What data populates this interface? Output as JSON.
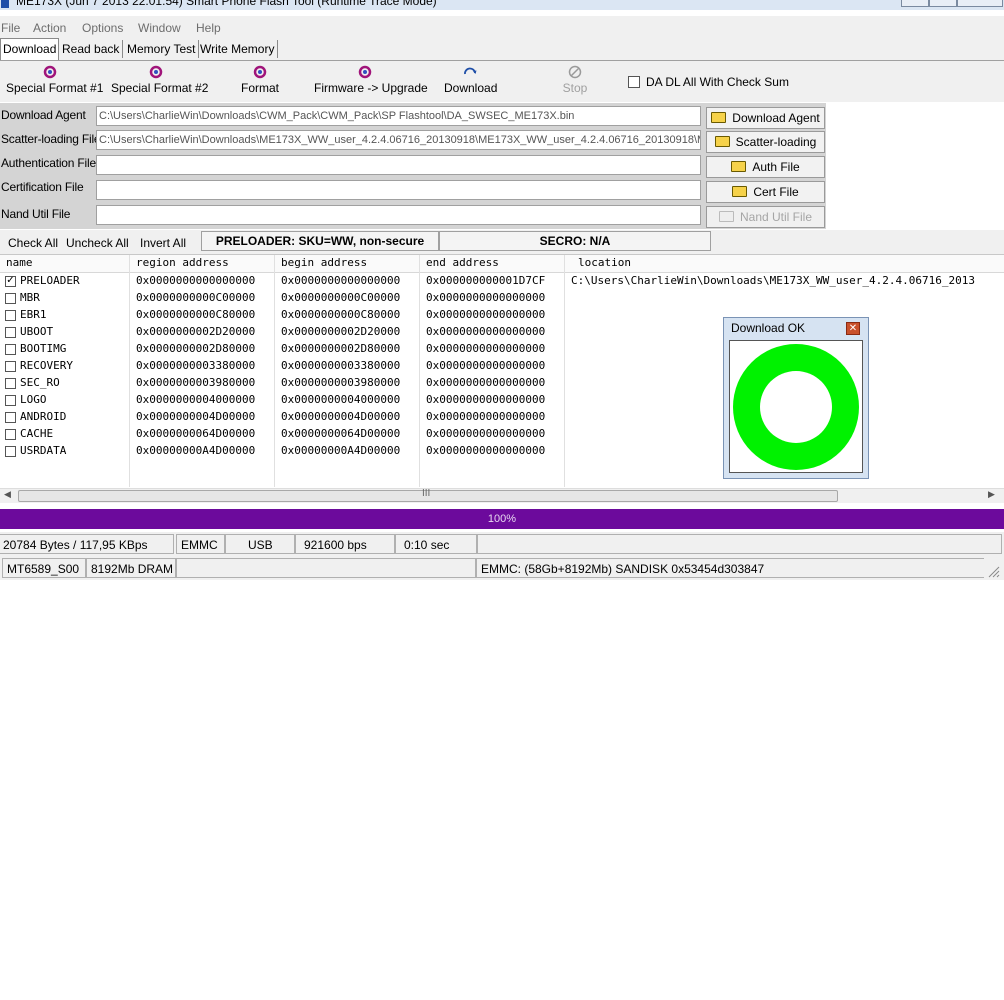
{
  "window": {
    "title": "ME173X (Jun  7 2013 22:01:54) Smart Phone Flash Tool (Runtime Trace Mode)"
  },
  "menu": [
    "File",
    "Action",
    "Options",
    "Window",
    "Help"
  ],
  "tabs": [
    "Download",
    "Read back",
    "Memory Test",
    "Write Memory"
  ],
  "toolbar": {
    "special_format_1": "Special Format #1",
    "special_format_2": "Special Format #2",
    "format": "Format",
    "firmware_upgrade": "Firmware -> Upgrade",
    "download": "Download",
    "stop": "Stop",
    "checksum_label": "DA DL All With Check Sum"
  },
  "files": {
    "download_agent": {
      "label": "Download Agent",
      "value": "C:\\Users\\CharlieWin\\Downloads\\CWM_Pack\\CWM_Pack\\SP Flashtool\\DA_SWSEC_ME173X.bin",
      "button": "Download Agent"
    },
    "scatter": {
      "label": "Scatter-loading File",
      "value": "C:\\Users\\CharlieWin\\Downloads\\ME173X_WW_user_4.2.4.06716_20130918\\ME173X_WW_user_4.2.4.06716_20130918\\M",
      "button": "Scatter-loading"
    },
    "auth": {
      "label": "Authentication File",
      "value": "",
      "button": "Auth File"
    },
    "cert": {
      "label": "Certification File",
      "value": "",
      "button": "Cert File"
    },
    "nand": {
      "label": "Nand Util File",
      "value": "",
      "button": "Nand Util File"
    }
  },
  "checks": {
    "check_all": "Check All",
    "uncheck_all": "Uncheck All",
    "invert_all": "Invert All",
    "preloader_info": "PRELOADER: SKU=WW, non-secure",
    "secro_info": "SECRO: N/A"
  },
  "table": {
    "columns": [
      "name",
      "region address",
      "begin address",
      "end address",
      "location"
    ],
    "rows": [
      {
        "checked": true,
        "name": "PRELOADER",
        "region": "0x0000000000000000",
        "begin": "0x0000000000000000",
        "end": "0x000000000001D7CF",
        "location": "C:\\Users\\CharlieWin\\Downloads\\ME173X_WW_user_4.2.4.06716_2013"
      },
      {
        "checked": false,
        "name": "MBR",
        "region": "0x0000000000C00000",
        "begin": "0x0000000000C00000",
        "end": "0x0000000000000000",
        "location": ""
      },
      {
        "checked": false,
        "name": "EBR1",
        "region": "0x0000000000C80000",
        "begin": "0x0000000000C80000",
        "end": "0x0000000000000000",
        "location": ""
      },
      {
        "checked": false,
        "name": "UBOOT",
        "region": "0x0000000002D20000",
        "begin": "0x0000000002D20000",
        "end": "0x0000000000000000",
        "location": ""
      },
      {
        "checked": false,
        "name": "BOOTIMG",
        "region": "0x0000000002D80000",
        "begin": "0x0000000002D80000",
        "end": "0x0000000000000000",
        "location": ""
      },
      {
        "checked": false,
        "name": "RECOVERY",
        "region": "0x0000000003380000",
        "begin": "0x0000000003380000",
        "end": "0x0000000000000000",
        "location": ""
      },
      {
        "checked": false,
        "name": "SEC_RO",
        "region": "0x0000000003980000",
        "begin": "0x0000000003980000",
        "end": "0x0000000000000000",
        "location": ""
      },
      {
        "checked": false,
        "name": "LOGO",
        "region": "0x0000000004000000",
        "begin": "0x0000000004000000",
        "end": "0x0000000000000000",
        "location": ""
      },
      {
        "checked": false,
        "name": "ANDROID",
        "region": "0x0000000004D00000",
        "begin": "0x0000000004D00000",
        "end": "0x0000000000000000",
        "location": ""
      },
      {
        "checked": false,
        "name": "CACHE",
        "region": "0x0000000064D00000",
        "begin": "0x0000000064D00000",
        "end": "0x0000000000000000",
        "location": ""
      },
      {
        "checked": false,
        "name": "USRDATA",
        "region": "0x00000000A4D00000",
        "begin": "0x00000000A4D00000",
        "end": "0x0000000000000000",
        "location": ""
      }
    ]
  },
  "scrollbar": {
    "grip": "III"
  },
  "progress": {
    "percent": 100,
    "text": "100%",
    "color": "#6c0a9c"
  },
  "status1": [
    "20784 Bytes / 117,95 KBps",
    "EMMC",
    "USB",
    "921600 bps",
    "0:10 sec"
  ],
  "status2": [
    "MT6589_S00",
    "8192Mb DRAM",
    "",
    "EMMC: (58Gb+8192Mb) SANDISK 0x53454d303847"
  ],
  "dialog": {
    "title": "Download OK",
    "ring_color": "#00f200"
  }
}
